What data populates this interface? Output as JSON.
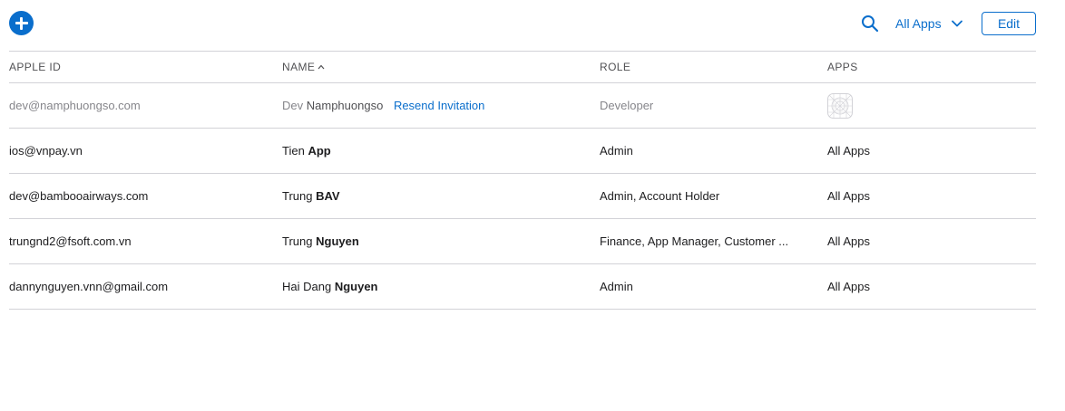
{
  "toolbar": {
    "add_icon": "plus-circle-icon",
    "search_icon": "magnifier-icon",
    "filter_label": "All Apps",
    "filter_icon": "chevron-down-icon",
    "edit_label": "Edit"
  },
  "colors": {
    "accent": "#0a6ecc",
    "border": "#d2d2d7",
    "muted_text": "#86868b"
  },
  "table": {
    "columns": {
      "apple_id": "APPLE ID",
      "name": "NAME",
      "role": "ROLE",
      "apps": "APPS"
    },
    "sort_column": "NAME",
    "sort_direction": "ascending",
    "rows": [
      {
        "apple_id": "dev@namphuongso.com",
        "first_name": "Dev",
        "last_name": "Namphuongso",
        "resend_label": "Resend Invitation",
        "role": "Developer",
        "apps": "app-placeholder-icon",
        "pending": true
      },
      {
        "apple_id": "ios@vnpay.vn",
        "first_name": "Tien",
        "last_name": "App",
        "role": "Admin",
        "apps": "All Apps"
      },
      {
        "apple_id": "dev@bambooairways.com",
        "first_name": "Trung",
        "last_name": "BAV",
        "role": "Admin, Account Holder",
        "apps": "All Apps"
      },
      {
        "apple_id": "trungnd2@fsoft.com.vn",
        "first_name": "Trung",
        "last_name": "Nguyen",
        "role": "Finance, App Manager, Customer ...",
        "apps": "All Apps"
      },
      {
        "apple_id": "dannynguyen.vnn@gmail.com",
        "first_name": "Hai Dang",
        "last_name": "Nguyen",
        "role": "Admin",
        "apps": "All Apps"
      }
    ]
  }
}
